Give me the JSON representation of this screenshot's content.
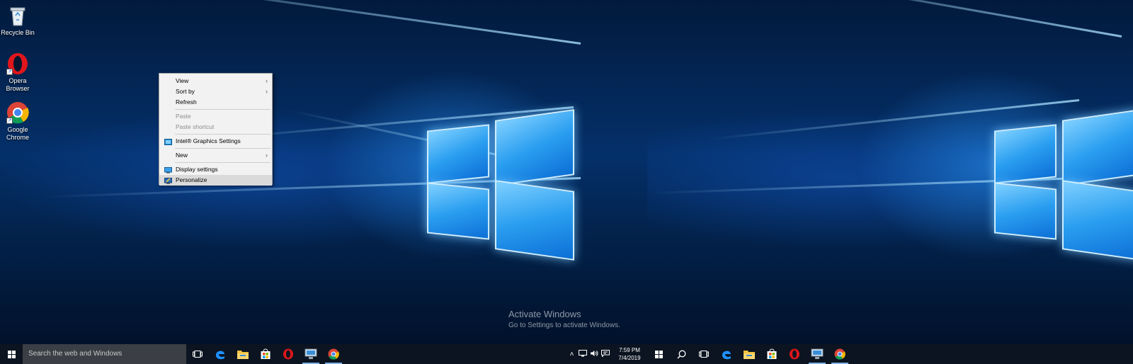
{
  "desktop": {
    "icons": [
      {
        "label": "Recycle Bin",
        "icon": "recycle-bin-icon"
      },
      {
        "label": "Opera\nBrowser",
        "icon": "opera-icon"
      },
      {
        "label": "Google\nChrome",
        "icon": "chrome-icon"
      }
    ],
    "watermark": {
      "title": "Activate Windows",
      "subtitle": "Go to Settings to activate Windows."
    }
  },
  "context_menu": {
    "items": [
      {
        "label": "View",
        "submenu": true,
        "enabled": true
      },
      {
        "label": "Sort by",
        "submenu": true,
        "enabled": true
      },
      {
        "label": "Refresh",
        "enabled": true
      },
      {
        "label": "Paste",
        "enabled": false
      },
      {
        "label": "Paste shortcut",
        "enabled": false
      },
      {
        "label": "Intel® Graphics Settings",
        "enabled": true,
        "icon": "intel-graphics-icon"
      },
      {
        "label": "New",
        "submenu": true,
        "enabled": true
      },
      {
        "label": "Display settings",
        "enabled": true,
        "icon": "display-icon"
      },
      {
        "label": "Personalize",
        "enabled": true,
        "icon": "personalize-icon",
        "highlighted": true
      }
    ]
  },
  "taskbar_main": {
    "search_placeholder": "Search the web and Windows",
    "apps": [
      "task-view-icon",
      "edge-icon",
      "file-explorer-icon",
      "store-icon",
      "opera-icon",
      "network-drive-icon",
      "chrome-icon"
    ],
    "clock": {
      "time": "7:59 PM",
      "date": "7/4/2019"
    }
  },
  "taskbar_secondary": {
    "apps": [
      "search-icon",
      "task-view-icon",
      "edge-icon",
      "file-explorer-icon",
      "store-icon",
      "opera-icon",
      "network-drive-icon",
      "chrome-icon"
    ]
  },
  "colors": {
    "taskbar": "#0b1420",
    "accent": "#0078d7",
    "menu_bg": "#f2f2f2"
  }
}
